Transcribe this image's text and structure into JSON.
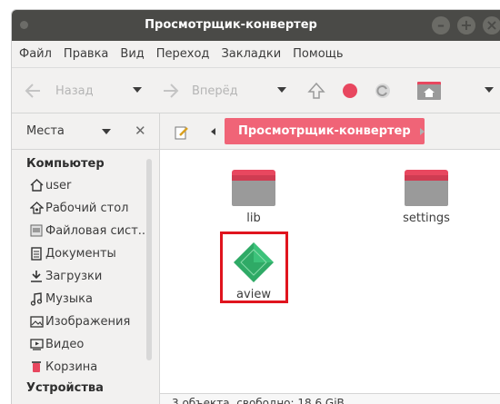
{
  "window": {
    "title": "Просмотрщик-конвертер"
  },
  "menu": {
    "items": [
      "Файл",
      "Правка",
      "Вид",
      "Переход",
      "Закладки",
      "Помощь"
    ]
  },
  "toolbar": {
    "back_label": "Назад",
    "forward_label": "Вперёд"
  },
  "places_bar": {
    "label": "Места"
  },
  "pathbar": {
    "current": "Просмотрщик-конвертер"
  },
  "sidebar": {
    "section_computer": "Компьютер",
    "items": [
      {
        "label": "user",
        "icon": "home-icon"
      },
      {
        "label": "Рабочий стол",
        "icon": "desktop-icon"
      },
      {
        "label": "Файловая сист...",
        "icon": "drive-icon"
      },
      {
        "label": "Документы",
        "icon": "document-icon"
      },
      {
        "label": "Загрузки",
        "icon": "download-icon"
      },
      {
        "label": "Музыка",
        "icon": "music-icon"
      },
      {
        "label": "Изображения",
        "icon": "image-icon"
      },
      {
        "label": "Видео",
        "icon": "video-icon"
      },
      {
        "label": "Корзина",
        "icon": "trash-icon"
      }
    ],
    "section_devices": "Устройства"
  },
  "files": [
    {
      "name": "lib",
      "type": "folder"
    },
    {
      "name": "settings",
      "type": "folder"
    },
    {
      "name": "aview",
      "type": "executable"
    }
  ],
  "status": {
    "text": "3 объекта, свободно: 18,6 GiB"
  },
  "colors": {
    "accent": "#f06477",
    "titlebar": "#4a4a47",
    "selection_outline": "#e0141e",
    "aview_icon": "#2faa66"
  }
}
